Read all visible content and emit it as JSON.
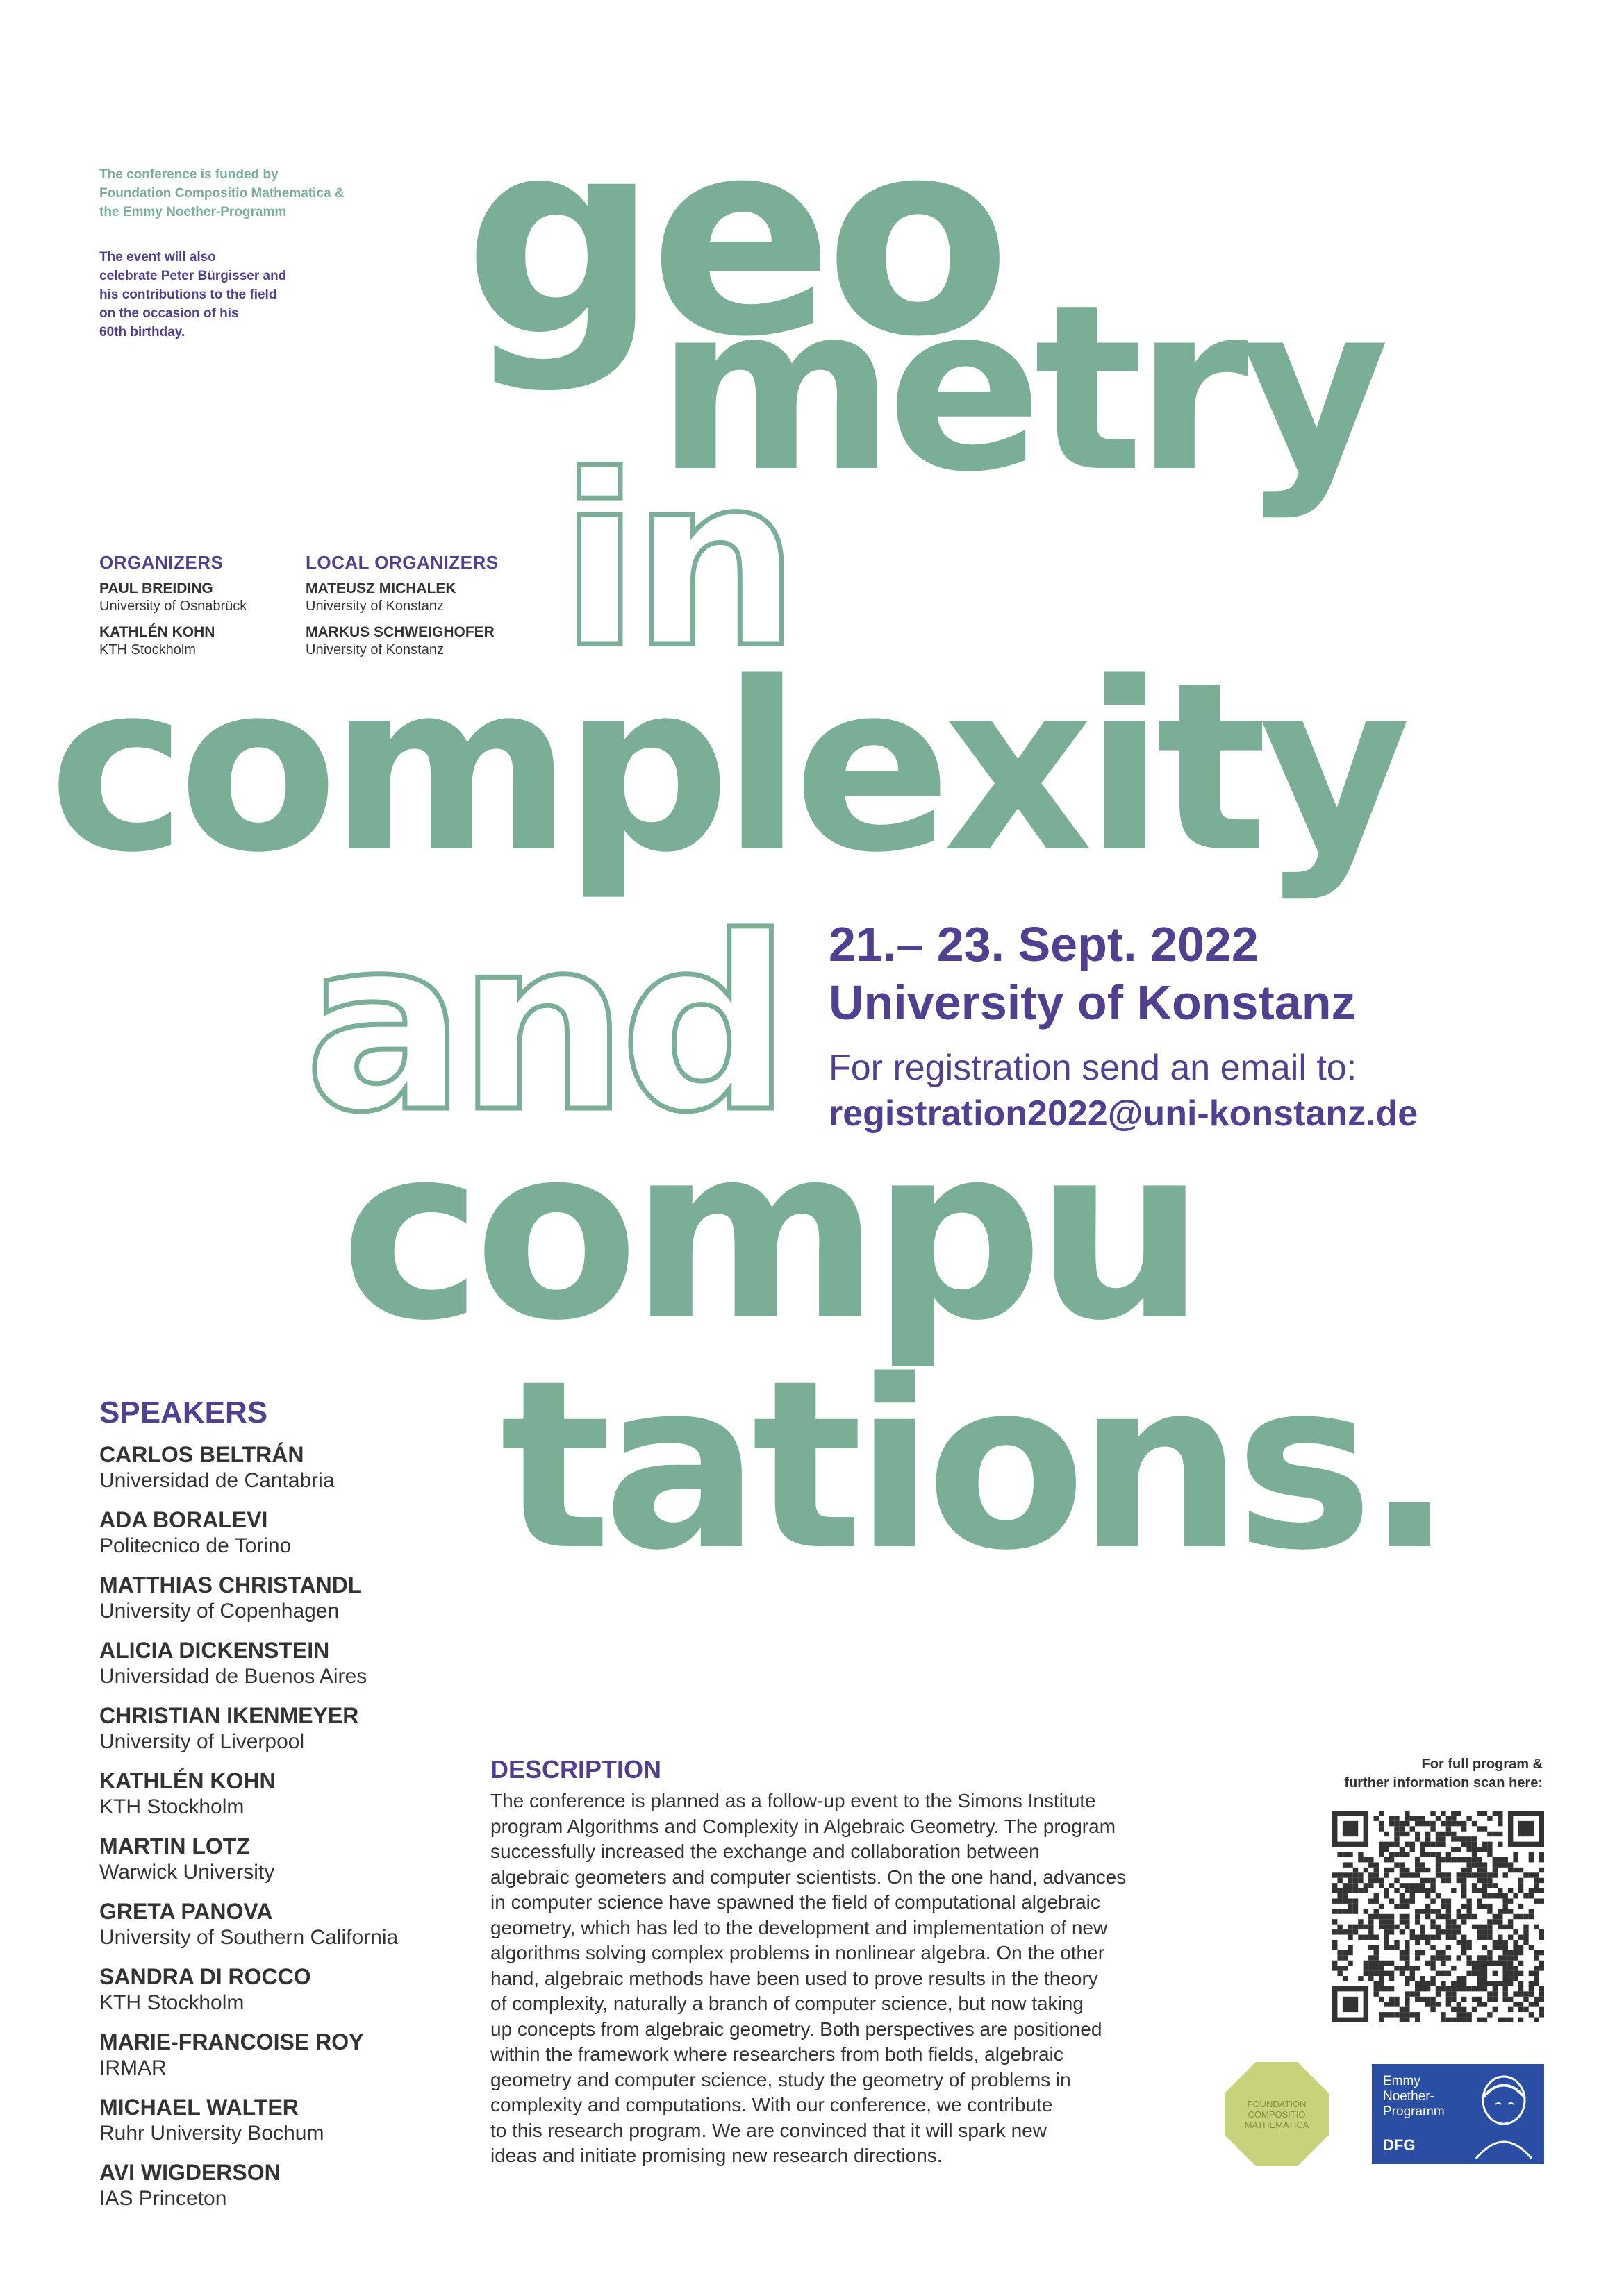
{
  "notes": {
    "funding": [
      "The conference is funded by",
      "Foundation Compositio Mathematica &",
      "the Emmy Noether-Programm"
    ],
    "birthday": [
      "The event will also",
      "celebrate Peter Bürgisser and",
      "his contributions to the field",
      "on the occasion of his",
      "60th birthday."
    ]
  },
  "organizers": {
    "heading": "ORGANIZERS",
    "people": [
      {
        "name": "PAUL BREIDING",
        "affiliation": "University of Osnabrück"
      },
      {
        "name": "KATHLÉN KOHN",
        "affiliation": "KTH Stockholm"
      }
    ]
  },
  "local_organizers": {
    "heading": "LOCAL ORGANIZERS",
    "people": [
      {
        "name": "MATEUSZ MICHALEK",
        "affiliation": "University of Konstanz"
      },
      {
        "name": "MARKUS SCHWEIGHOFER",
        "affiliation": "University of Konstanz"
      }
    ]
  },
  "title_words": {
    "w1": "geo",
    "w2": "metry",
    "w3": "in",
    "w4": "complexity",
    "w5": "and",
    "w6": "compu",
    "w7": "tations."
  },
  "event": {
    "dates": "21.– 23. Sept. 2022",
    "venue": "University of Konstanz",
    "registration_label": "For registration send an email to:",
    "email": "registration2022@uni-konstanz.de"
  },
  "speakers": {
    "heading": "SPEAKERS",
    "list": [
      {
        "name": "CARLOS BELTRÁN",
        "affiliation": "Universidad de Cantabria"
      },
      {
        "name": "ADA BORALEVI",
        "affiliation": "Politecnico de Torino"
      },
      {
        "name": "MATTHIAS CHRISTANDL",
        "affiliation": "University of Copenhagen"
      },
      {
        "name": "ALICIA DICKENSTEIN",
        "affiliation": "Universidad de Buenos Aires"
      },
      {
        "name": "CHRISTIAN IKENMEYER",
        "affiliation": "University of Liverpool"
      },
      {
        "name": "KATHLÉN KOHN",
        "affiliation": "KTH Stockholm"
      },
      {
        "name": "MARTIN LOTZ",
        "affiliation": "Warwick University"
      },
      {
        "name": "GRETA PANOVA",
        "affiliation": "University of Southern California"
      },
      {
        "name": "SANDRA DI ROCCO",
        "affiliation": "KTH Stockholm"
      },
      {
        "name": "MARIE-FRANCOISE ROY",
        "affiliation": "IRMAR"
      },
      {
        "name": "MICHAEL WALTER",
        "affiliation": "Ruhr University Bochum"
      },
      {
        "name": "AVI WIGDERSON",
        "affiliation": "IAS Princeton"
      }
    ]
  },
  "description": {
    "heading": "DESCRIPTION",
    "lines": [
      "The conference is planned as a follow-up event to the Simons Institute",
      "program Algorithms and Complexity in Algebraic Geometry. The program",
      "successfully increased the exchange and collaboration between",
      "algebraic geometers and computer scientists. On the one hand, advances",
      "in computer science have spawned the field of computational algebraic",
      "geometry, which has led to the development and implementation of new",
      "algorithms solving complex problems in nonlinear algebra. On the other",
      "hand, algebraic methods have been used to prove results in the theory",
      "of complexity, naturally a branch of computer science, but now taking",
      "up concepts from algebraic geometry. Both perspectives are positioned",
      "within the framework where researchers from both fields, algebraic",
      "geometry and computer science, study the geometry of problems in",
      "complexity and computations. With our conference, we contribute",
      "to this research program. We are convinced that it will spark new",
      "ideas and initiate promising new research directions."
    ]
  },
  "qr": {
    "label": [
      "For full program &",
      "further information scan here:"
    ]
  },
  "logos": {
    "fcm": [
      "FOUNDATION",
      "COMPOSITIO",
      "MATHEMATICA"
    ],
    "dfg": [
      "Emmy",
      "Noether-",
      "Programm",
      "DFG"
    ]
  },
  "colors": {
    "green": "#7aae97",
    "purple": "#50408f",
    "text": "#333333"
  }
}
